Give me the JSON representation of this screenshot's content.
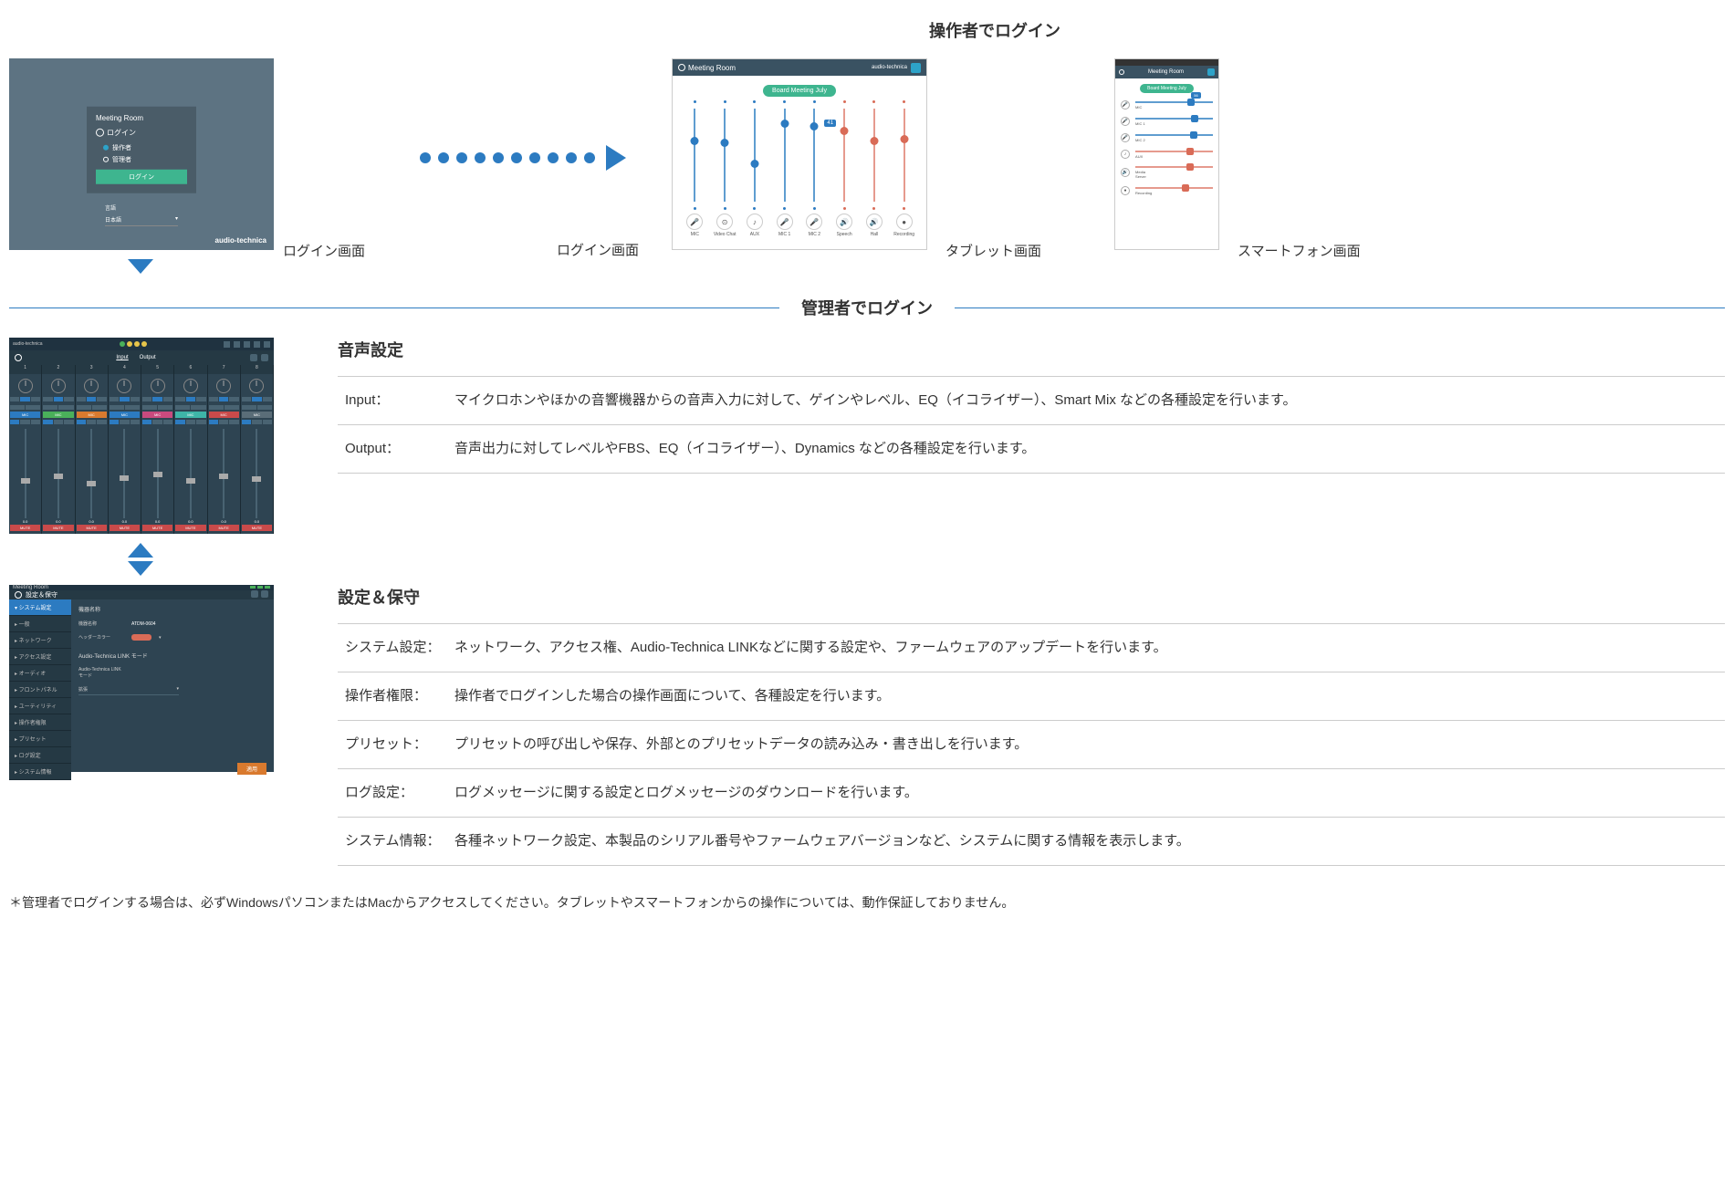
{
  "headers": {
    "operator_login": "操作者でログイン",
    "admin_login": "管理者でログイン"
  },
  "login": {
    "window_title": "Meeting Room",
    "title": "ログイン",
    "radio_operator": "操作者",
    "radio_admin": "管理者",
    "button": "ログイン",
    "lang_label": "言語",
    "lang_value": "日本語",
    "brand": "audio-technica",
    "caption": "ログイン画面"
  },
  "tablet": {
    "title": "Meeting Room",
    "brand": "audio-technica",
    "chip": "Board Meeting July",
    "callout": "41",
    "channels": [
      {
        "label": "MIC",
        "color": "blue",
        "pos": 30,
        "icon": "🎤"
      },
      {
        "label": "Video Chat",
        "color": "blue",
        "pos": 32,
        "icon": "⊙"
      },
      {
        "label": "AUX",
        "color": "blue",
        "pos": 55,
        "icon": "♪"
      },
      {
        "label": "MIC 1",
        "color": "blue",
        "pos": 12,
        "icon": "🎤"
      },
      {
        "label": "MIC 2",
        "color": "blue",
        "pos": 15,
        "icon": "🎤"
      },
      {
        "label": "Speech",
        "color": "red",
        "pos": 20,
        "icon": "🔊"
      },
      {
        "label": "Hall",
        "color": "red",
        "pos": 30,
        "icon": "🔊"
      },
      {
        "label": "Recording",
        "color": "red",
        "pos": 28,
        "icon": "●"
      }
    ],
    "caption": "タブレット画面"
  },
  "phone": {
    "title": "Meeting Room",
    "chip": "Board Meeting July",
    "badge": "56",
    "channels": [
      {
        "label": "MIC",
        "color": "blue",
        "pos": 72,
        "icon": "🎤",
        "badge": true
      },
      {
        "label": "MIC 1",
        "color": "blue",
        "pos": 76,
        "icon": "🎤"
      },
      {
        "label": "MIC 2",
        "color": "blue",
        "pos": 75,
        "icon": "🎤"
      },
      {
        "label": "AUX",
        "color": "red",
        "pos": 70,
        "icon": "♪"
      },
      {
        "label": "Media Server",
        "color": "red",
        "pos": 70,
        "icon": "🔊"
      },
      {
        "label": "Recording",
        "color": "red",
        "pos": 65,
        "icon": "●"
      }
    ],
    "caption": "スマートフォン画面"
  },
  "mixer": {
    "brand": "audio-technica",
    "tab_input": "Input",
    "tab_output": "Output",
    "ch_nums": [
      "1",
      "2",
      "3",
      "4",
      "5",
      "6",
      "7",
      "8"
    ],
    "strips": [
      {
        "tag": "MIC",
        "tagc": "blue",
        "fpos": 55
      },
      {
        "tag": "MIC",
        "tagc": "green",
        "fpos": 50
      },
      {
        "tag": "MIC",
        "tagc": "orange",
        "fpos": 58
      },
      {
        "tag": "MIC",
        "tagc": "blue",
        "fpos": 52
      },
      {
        "tag": "MIC",
        "tagc": "pink",
        "fpos": 48
      },
      {
        "tag": "MIC",
        "tagc": "cyan",
        "fpos": 55
      },
      {
        "tag": "MIC",
        "tagc": "red",
        "fpos": 50
      },
      {
        "tag": "MIC",
        "tagc": "grey",
        "fpos": 53
      }
    ]
  },
  "settings": {
    "window_title": "Meeting Room",
    "page_title": "設定＆保守",
    "side": [
      {
        "label": "システム設定",
        "active": true
      },
      {
        "label": "一般",
        "active": false,
        "sub": true
      },
      {
        "label": "ネットワーク",
        "active": false
      },
      {
        "label": "アクセス設定",
        "active": false
      },
      {
        "label": "オーディオ",
        "active": false
      },
      {
        "label": "フロントパネル",
        "active": false
      },
      {
        "label": "ユーティリティ",
        "active": false
      },
      {
        "label": "操作者権限",
        "active": false
      },
      {
        "label": "プリセット",
        "active": false
      },
      {
        "label": "ログ設定",
        "active": false
      },
      {
        "label": "システム情報",
        "active": false
      }
    ],
    "group1": "機器名称",
    "fld_name_l": "機器名称",
    "fld_name_v": "ATDM-0604",
    "fld_color_l": "ヘッダーカラー",
    "group2": "Audio-Technica LINK モード",
    "fld_link_l": "Audio-Technica LINK モード",
    "fld_link_v": "拡張",
    "apply": "適用"
  },
  "audio": {
    "title": "音声設定",
    "rows": [
      {
        "k": "Input：",
        "v": "マイクロホンやほかの音響機器からの音声入力に対して、ゲインやレベル、EQ（イコライザー）、Smart Mix などの各種設定を行います。"
      },
      {
        "k": "Output：",
        "v": "音声出力に対してレベルやFBS、EQ（イコライザー）、Dynamics などの各種設定を行います。"
      }
    ]
  },
  "maint": {
    "title": "設定＆保守",
    "rows": [
      {
        "k": "システム設定：",
        "v": "ネットワーク、アクセス権、Audio-Technica LINKなどに関する設定や、ファームウェアのアップデートを行います。"
      },
      {
        "k": "操作者権限：",
        "v": "操作者でログインした場合の操作画面について、各種設定を行います。"
      },
      {
        "k": "プリセット：",
        "v": "プリセットの呼び出しや保存、外部とのプリセットデータの読み込み・書き出しを行います。"
      },
      {
        "k": "ログ設定：",
        "v": "ログメッセージに関する設定とログメッセージのダウンロードを行います。"
      },
      {
        "k": "システム情報：",
        "v": "各種ネットワーク設定、本製品のシリアル番号やファームウェアバージョンなど、システムに関する情報を表示します。"
      }
    ]
  },
  "footnote": "＊管理者でログインする場合は、必ずWindowsパソコンまたはMacからアクセスしてください。タブレットやスマートフォンからの操作については、動作保証しておりません。"
}
